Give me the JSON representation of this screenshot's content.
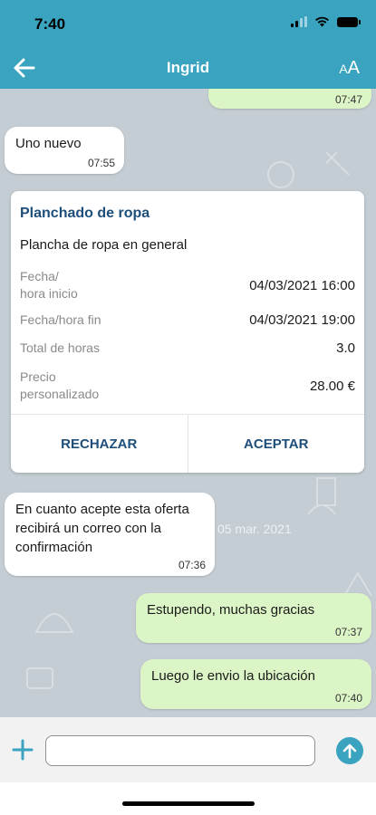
{
  "status_bar": {
    "time": "7:40"
  },
  "header": {
    "title": "Ingrid",
    "font_size_label_small": "A",
    "font_size_label_large": "A"
  },
  "messages": [
    {
      "direction": "out",
      "text": "",
      "time": "07:47"
    },
    {
      "direction": "in",
      "text": "Uno nuevo",
      "time": "07:55"
    },
    {
      "direction": "in",
      "text": "En cuanto acepte esta oferta recibirá un correo con la confirmación",
      "time": "07:36"
    },
    {
      "direction": "out",
      "text": "Estupendo, muchas gracias",
      "time": "07:37"
    },
    {
      "direction": "out",
      "text": "Luego le envio la ubicación",
      "time": "07:40"
    }
  ],
  "date_separator": "05 mar. 2021",
  "offer_card": {
    "title": "Planchado de ropa",
    "description": "Plancha de ropa en general",
    "rows": [
      {
        "label": "Fecha/\nhora inicio",
        "value": "04/03/2021 16:00"
      },
      {
        "label": "Fecha/hora fin",
        "value": "04/03/2021 19:00"
      },
      {
        "label": "Total de horas",
        "value": "3.0"
      },
      {
        "label": "Precio\npersonalizado",
        "value": "28.00 €"
      }
    ],
    "reject_label": "RECHAZAR",
    "accept_label": "ACEPTAR"
  },
  "composer": {
    "placeholder": ""
  },
  "colors": {
    "header": "#3aa3bf",
    "chat_background": "#c4cdd3",
    "outgoing_bubble": "#dcf5c6",
    "incoming_bubble": "#ffffff",
    "card_accent": "#1d4f7a"
  }
}
